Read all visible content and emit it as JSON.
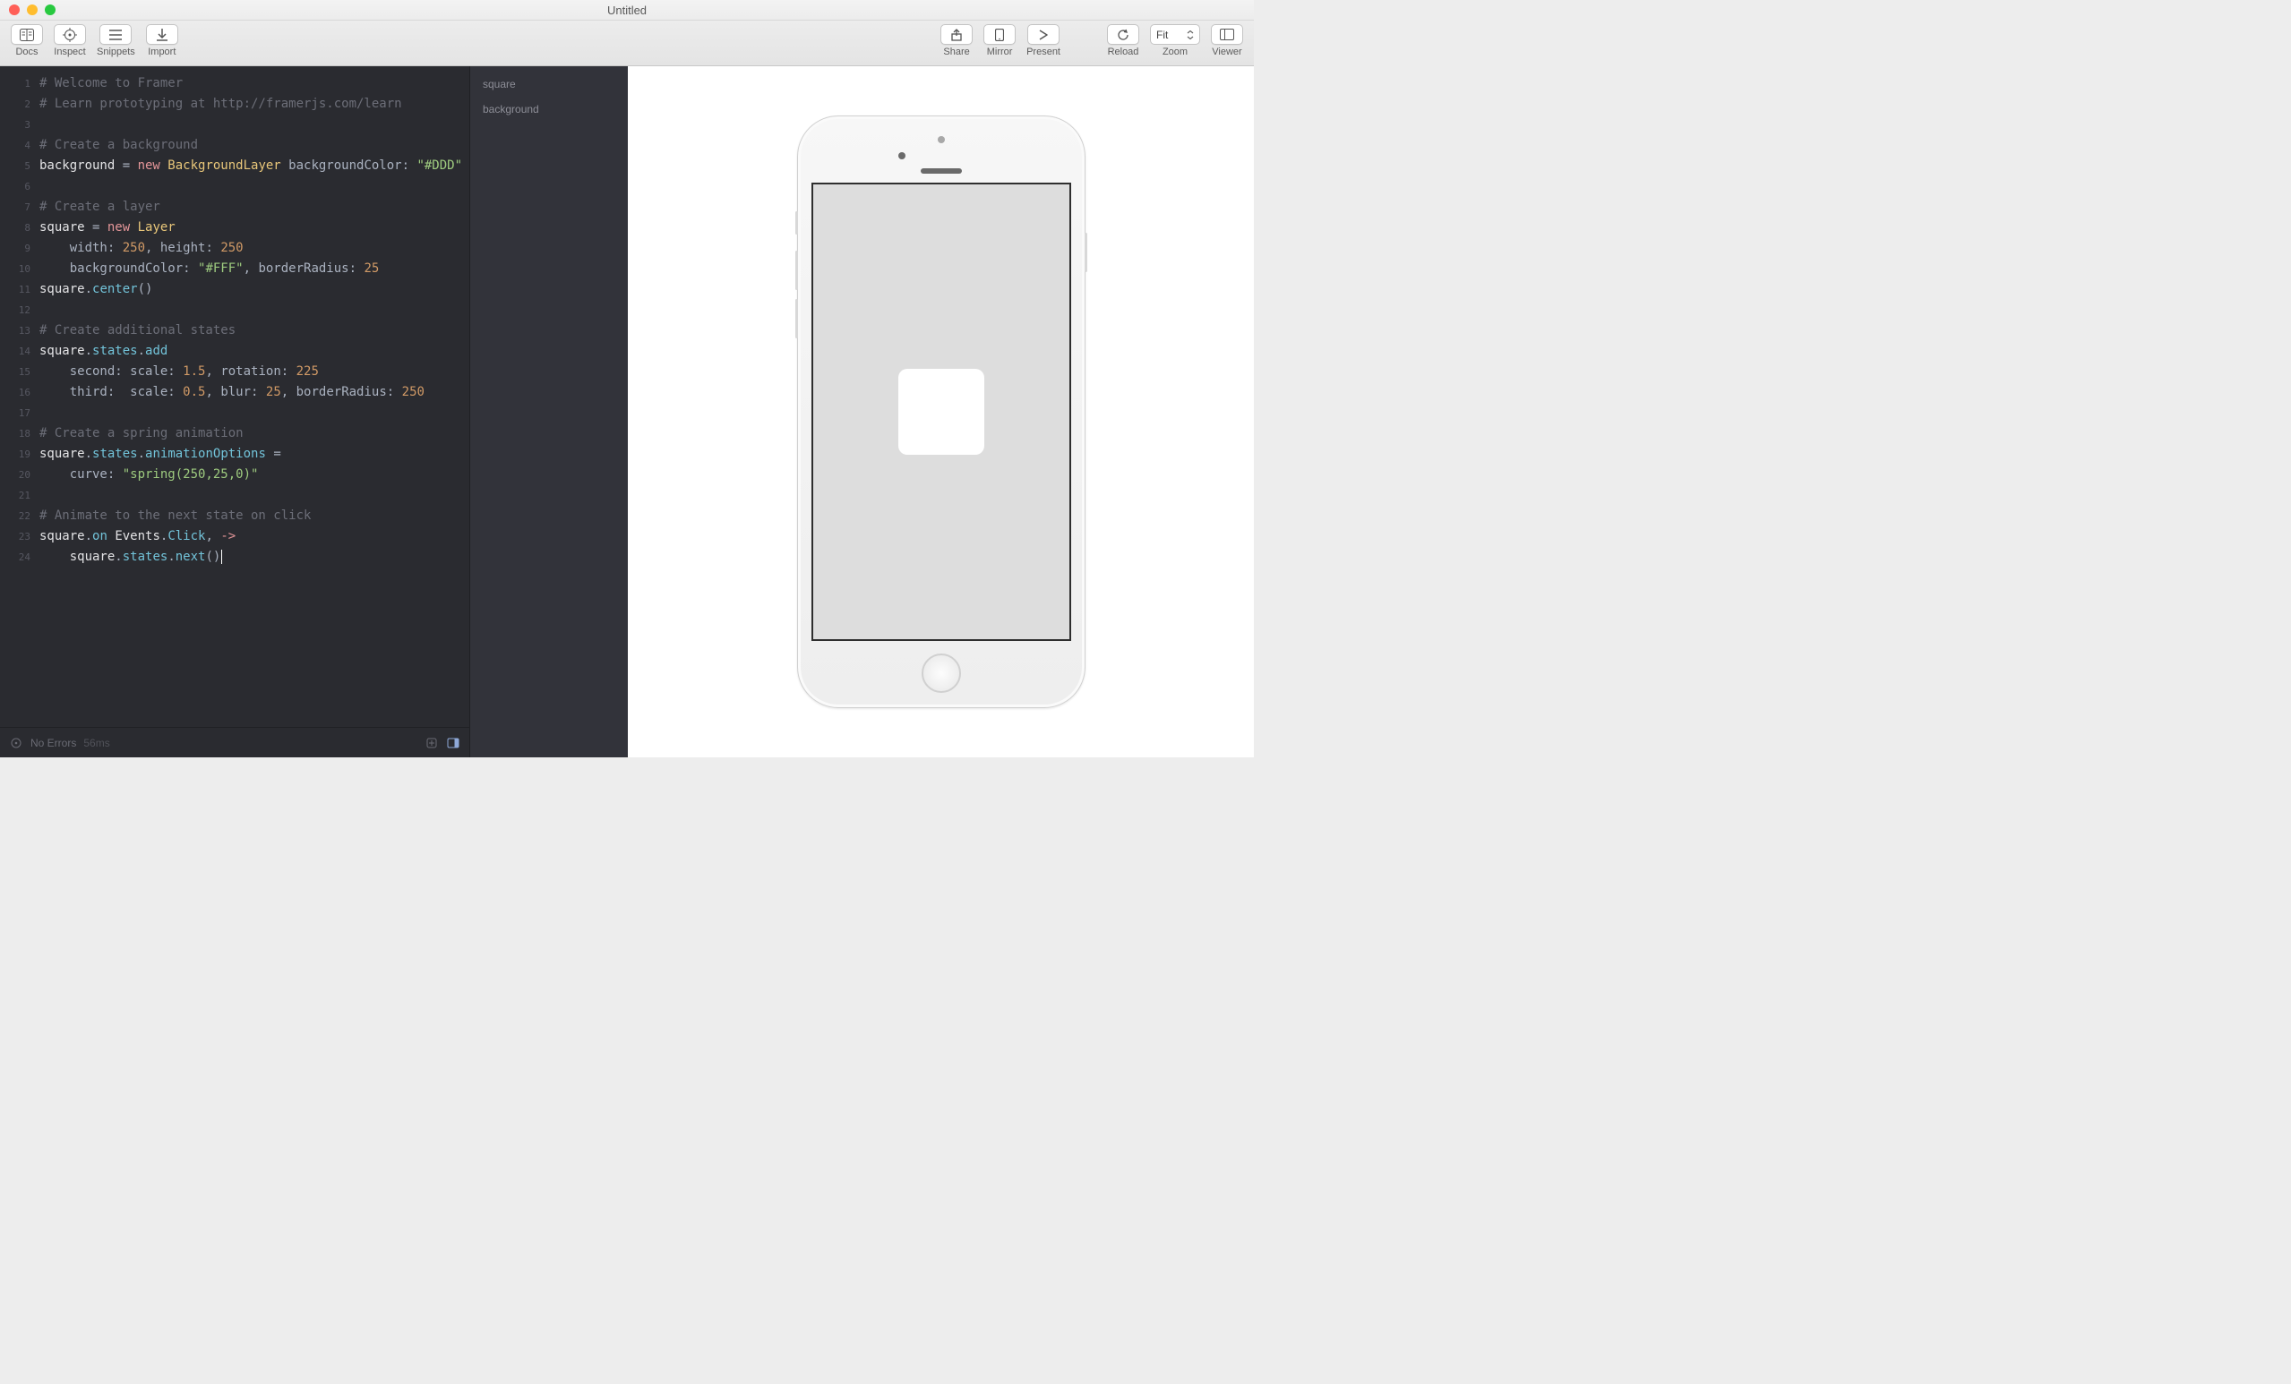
{
  "window": {
    "title": "Untitled"
  },
  "toolbar": {
    "left": [
      {
        "label": "Docs"
      },
      {
        "label": "Inspect"
      },
      {
        "label": "Snippets"
      },
      {
        "label": "Import"
      }
    ],
    "right": [
      {
        "label": "Share"
      },
      {
        "label": "Mirror"
      },
      {
        "label": "Present"
      },
      {
        "label": "Reload"
      },
      {
        "label": "Zoom",
        "select_value": "Fit"
      },
      {
        "label": "Viewer"
      }
    ]
  },
  "layers": [
    "square",
    "background"
  ],
  "status": {
    "errors": "No Errors",
    "time": "56ms"
  },
  "code_lines": [
    {
      "n": 1,
      "tokens": [
        {
          "t": "comment",
          "v": "# Welcome to Framer"
        }
      ]
    },
    {
      "n": 2,
      "tokens": [
        {
          "t": "comment",
          "v": "# Learn prototyping at http://framerjs.com/learn"
        }
      ]
    },
    {
      "n": 3,
      "tokens": []
    },
    {
      "n": 4,
      "tokens": [
        {
          "t": "comment",
          "v": "# Create a background"
        }
      ]
    },
    {
      "n": 5,
      "tokens": [
        {
          "t": "ident",
          "v": "background "
        },
        {
          "t": "op",
          "v": "= "
        },
        {
          "t": "keyword",
          "v": "new "
        },
        {
          "t": "class",
          "v": "BackgroundLayer "
        },
        {
          "t": "prop",
          "v": "backgroundColor: "
        },
        {
          "t": "string",
          "v": "\"#DDD\""
        }
      ]
    },
    {
      "n": 6,
      "tokens": []
    },
    {
      "n": 7,
      "tokens": [
        {
          "t": "comment",
          "v": "# Create a layer"
        }
      ]
    },
    {
      "n": 8,
      "tokens": [
        {
          "t": "ident",
          "v": "square "
        },
        {
          "t": "op",
          "v": "= "
        },
        {
          "t": "keyword",
          "v": "new "
        },
        {
          "t": "class",
          "v": "Layer"
        }
      ]
    },
    {
      "n": 9,
      "tokens": [
        {
          "t": "prop",
          "v": "    width: "
        },
        {
          "t": "number",
          "v": "250"
        },
        {
          "t": "op",
          "v": ", "
        },
        {
          "t": "prop",
          "v": "height: "
        },
        {
          "t": "number",
          "v": "250"
        }
      ]
    },
    {
      "n": 10,
      "tokens": [
        {
          "t": "prop",
          "v": "    backgroundColor: "
        },
        {
          "t": "string",
          "v": "\"#FFF\""
        },
        {
          "t": "op",
          "v": ", "
        },
        {
          "t": "prop",
          "v": "borderRadius: "
        },
        {
          "t": "number",
          "v": "25"
        }
      ]
    },
    {
      "n": 11,
      "tokens": [
        {
          "t": "ident",
          "v": "square"
        },
        {
          "t": "op",
          "v": "."
        },
        {
          "t": "func",
          "v": "center"
        },
        {
          "t": "op",
          "v": "()"
        }
      ]
    },
    {
      "n": 12,
      "tokens": []
    },
    {
      "n": 13,
      "tokens": [
        {
          "t": "comment",
          "v": "# Create additional states"
        }
      ]
    },
    {
      "n": 14,
      "tokens": [
        {
          "t": "ident",
          "v": "square"
        },
        {
          "t": "op",
          "v": "."
        },
        {
          "t": "func",
          "v": "states"
        },
        {
          "t": "op",
          "v": "."
        },
        {
          "t": "func",
          "v": "add"
        }
      ]
    },
    {
      "n": 15,
      "tokens": [
        {
          "t": "prop",
          "v": "    second: "
        },
        {
          "t": "prop",
          "v": "scale: "
        },
        {
          "t": "number",
          "v": "1.5"
        },
        {
          "t": "op",
          "v": ", "
        },
        {
          "t": "prop",
          "v": "rotation: "
        },
        {
          "t": "number",
          "v": "225"
        }
      ]
    },
    {
      "n": 16,
      "tokens": [
        {
          "t": "prop",
          "v": "    third:  "
        },
        {
          "t": "prop",
          "v": "scale: "
        },
        {
          "t": "number",
          "v": "0.5"
        },
        {
          "t": "op",
          "v": ", "
        },
        {
          "t": "prop",
          "v": "blur: "
        },
        {
          "t": "number",
          "v": "25"
        },
        {
          "t": "op",
          "v": ", "
        },
        {
          "t": "prop",
          "v": "borderRadius: "
        },
        {
          "t": "number",
          "v": "250"
        }
      ]
    },
    {
      "n": 17,
      "tokens": []
    },
    {
      "n": 18,
      "tokens": [
        {
          "t": "comment",
          "v": "# Create a spring animation"
        }
      ]
    },
    {
      "n": 19,
      "tokens": [
        {
          "t": "ident",
          "v": "square"
        },
        {
          "t": "op",
          "v": "."
        },
        {
          "t": "func",
          "v": "states"
        },
        {
          "t": "op",
          "v": "."
        },
        {
          "t": "func",
          "v": "animationOptions "
        },
        {
          "t": "op",
          "v": "="
        }
      ]
    },
    {
      "n": 20,
      "tokens": [
        {
          "t": "prop",
          "v": "    curve: "
        },
        {
          "t": "string",
          "v": "\"spring(250,25,0)\""
        }
      ]
    },
    {
      "n": 21,
      "tokens": []
    },
    {
      "n": 22,
      "tokens": [
        {
          "t": "comment",
          "v": "# Animate to the next state on click"
        }
      ]
    },
    {
      "n": 23,
      "tokens": [
        {
          "t": "ident",
          "v": "square"
        },
        {
          "t": "op",
          "v": "."
        },
        {
          "t": "func",
          "v": "on "
        },
        {
          "t": "ident",
          "v": "Events"
        },
        {
          "t": "op",
          "v": "."
        },
        {
          "t": "func",
          "v": "Click"
        },
        {
          "t": "op",
          "v": ", "
        },
        {
          "t": "keyword",
          "v": "->"
        }
      ]
    },
    {
      "n": 24,
      "tokens": [
        {
          "t": "ident",
          "v": "    square"
        },
        {
          "t": "op",
          "v": "."
        },
        {
          "t": "func",
          "v": "states"
        },
        {
          "t": "op",
          "v": "."
        },
        {
          "t": "func",
          "v": "next"
        },
        {
          "t": "op",
          "v": "()"
        }
      ],
      "cursor": true
    }
  ],
  "preview": {
    "background_color": "#DDD",
    "square": {
      "size": 96,
      "radius": 10,
      "color": "#FFF"
    }
  }
}
